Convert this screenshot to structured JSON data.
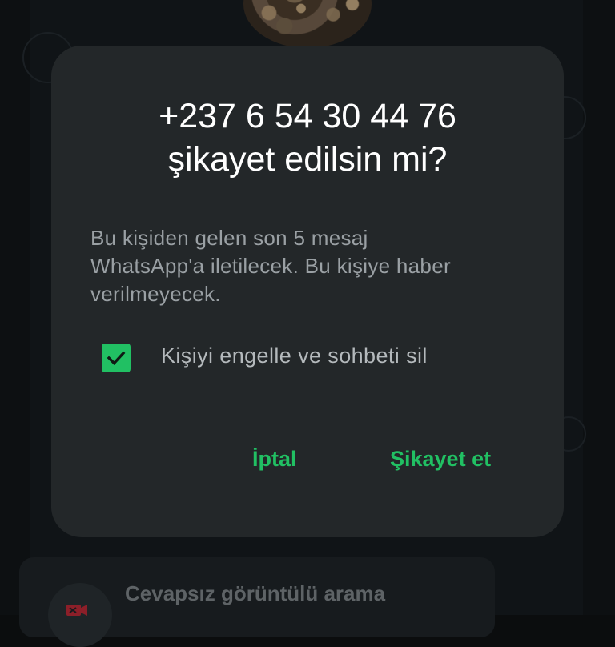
{
  "dialog": {
    "title_line1": "+237 6 54 30 44 76",
    "title_line2": "şikayet edilsin mi?",
    "message_line1": "Bu kişiden gelen son 5 mesaj",
    "message_line2": "WhatsApp'a iletilecek. Bu kişiye haber",
    "message_line3": "verilmeyecek.",
    "checkbox": {
      "label": "Kişiyi engelle ve sohbeti sil",
      "checked": true
    },
    "buttons": {
      "cancel": "İptal",
      "report": "Şikayet et"
    }
  },
  "background": {
    "missed_call_text": "Cevapsız görüntülü arama"
  },
  "colors": {
    "accent": "#21c063",
    "dialog_bg": "#232729",
    "title": "#ffffff",
    "message": "#9aa0a4"
  }
}
